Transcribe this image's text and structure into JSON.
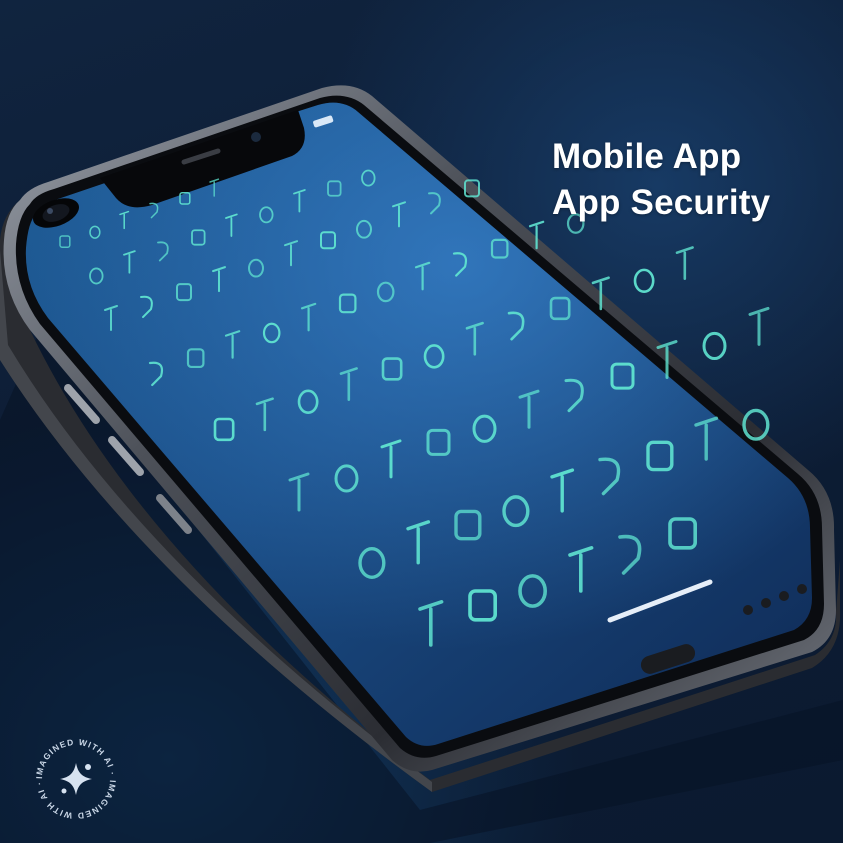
{
  "caption": {
    "line1": "Mobile App",
    "line2": "App Security"
  },
  "watermark": {
    "text": "IMAGINED WITH AI · IMAGINED WITH AI ·"
  },
  "colors": {
    "background": "#0d1d35",
    "screen_glow": "#2f6fb8",
    "glyph": "#5fe3d0",
    "frame": "#6b6f78",
    "caption_text": "#ffffff"
  },
  "icons": [
    "front-camera-icon",
    "earpiece-speaker-icon",
    "home-indicator-icon",
    "ai-sparkle-icon"
  ]
}
